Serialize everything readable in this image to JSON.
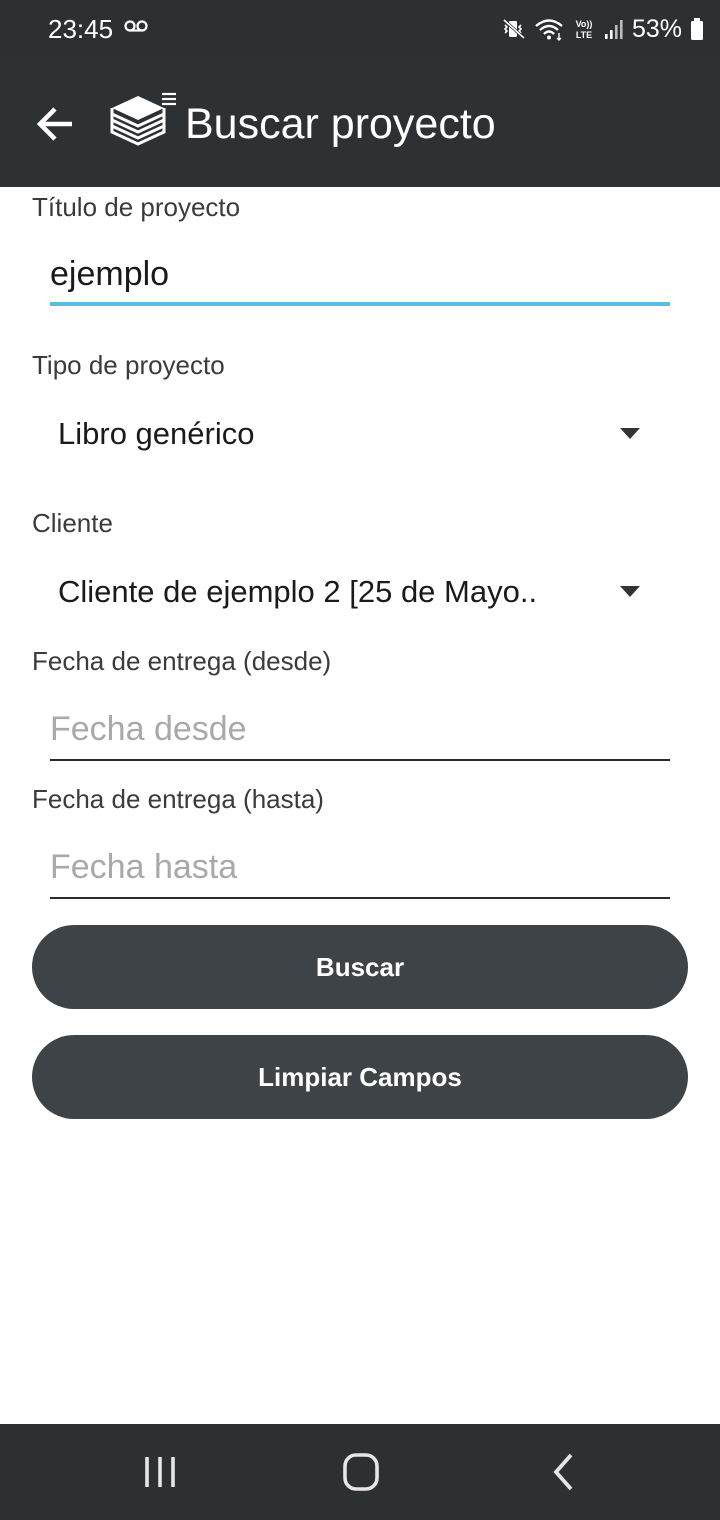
{
  "status_bar": {
    "time": "23:45",
    "network_label": "VoLTE",
    "battery": "53%",
    "icons": [
      "voicemail-icon",
      "vibrate-icon",
      "wifi-icon",
      "volte-icon",
      "signal-icon",
      "battery-icon"
    ]
  },
  "app_bar": {
    "title": "Buscar proyecto",
    "back_icon": "arrow-left-icon",
    "logo_icon": "stacked-books-icon"
  },
  "form": {
    "title_field": {
      "label": "Título de proyecto",
      "value": "ejemplo"
    },
    "type_field": {
      "label": "Tipo de proyecto",
      "value": "Libro genérico"
    },
    "client_field": {
      "label": "Cliente",
      "value": "Cliente de ejemplo 2 [25 de Mayo.."
    },
    "date_from_field": {
      "label": "Fecha de entrega (desde)",
      "placeholder": "Fecha desde"
    },
    "date_to_field": {
      "label": "Fecha de entrega (hasta)",
      "placeholder": "Fecha hasta"
    }
  },
  "buttons": {
    "search": "Buscar",
    "clear": "Limpiar Campos"
  },
  "nav_bar": {
    "items": [
      "recents-icon",
      "home-icon",
      "back-icon"
    ]
  },
  "colors": {
    "app_bar": "#2d3134",
    "accent": "#5cbbe4",
    "button": "#3e4347",
    "placeholder": "#a9a9a9"
  }
}
